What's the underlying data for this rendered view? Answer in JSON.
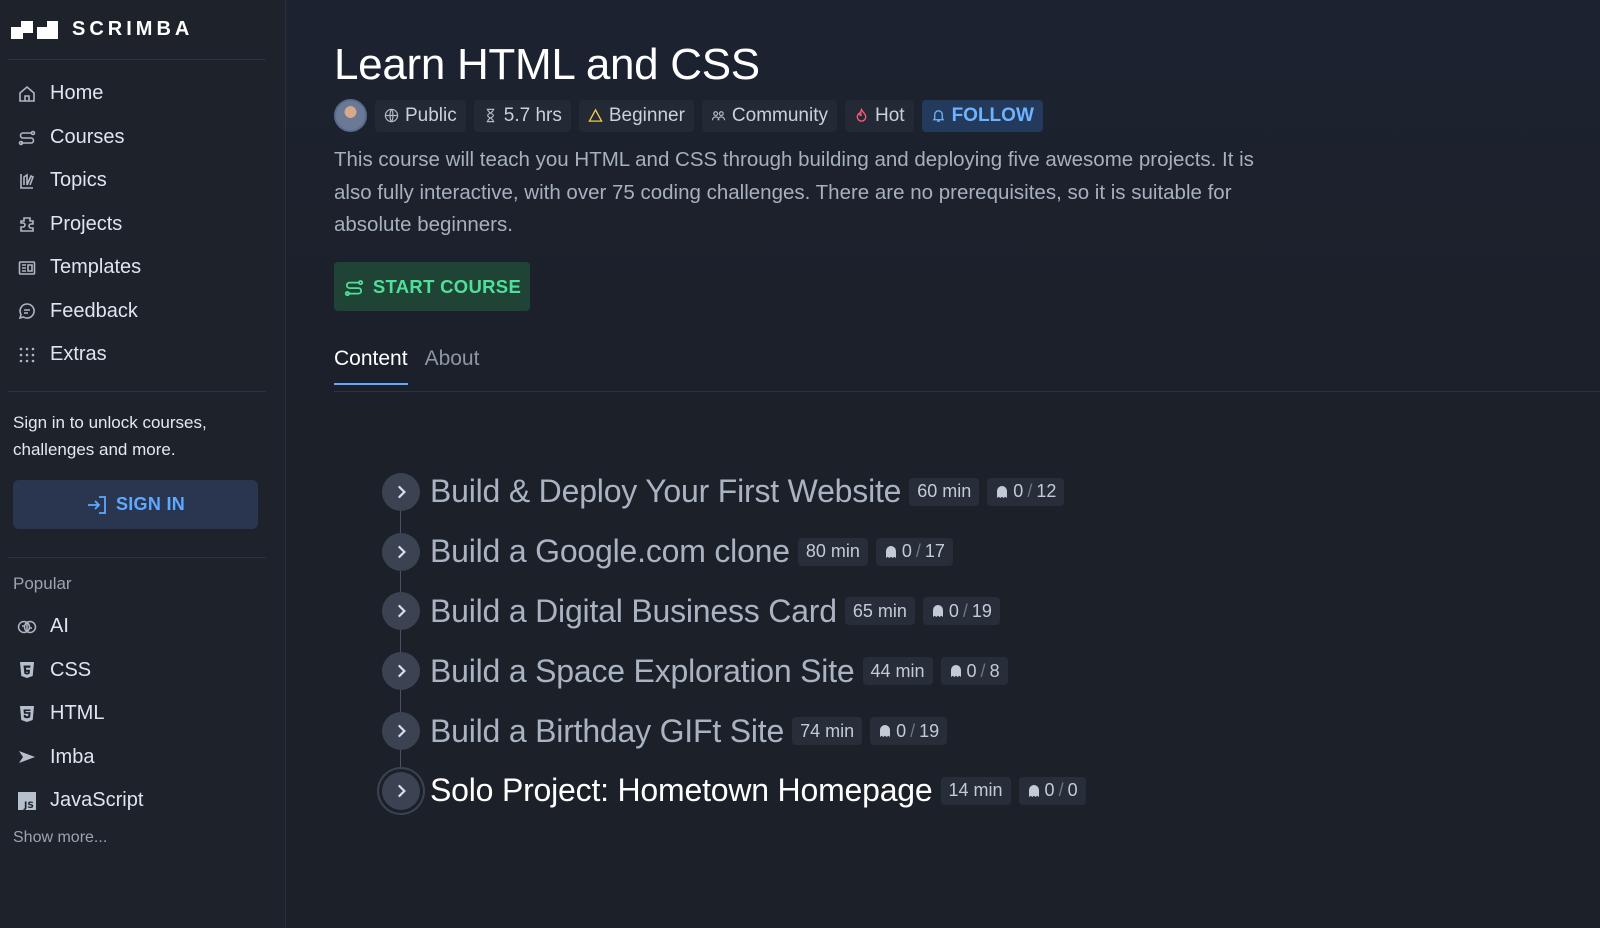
{
  "brand": {
    "name": "SCRIMBA"
  },
  "sidebar": {
    "nav": [
      {
        "label": "Home",
        "icon": "home-icon"
      },
      {
        "label": "Courses",
        "icon": "courses-icon"
      },
      {
        "label": "Topics",
        "icon": "topics-icon"
      },
      {
        "label": "Projects",
        "icon": "projects-icon"
      },
      {
        "label": "Templates",
        "icon": "templates-icon"
      },
      {
        "label": "Feedback",
        "icon": "feedback-icon"
      },
      {
        "label": "Extras",
        "icon": "extras-icon"
      }
    ],
    "signin_text": "Sign in to unlock courses, challenges and more.",
    "signin_button": "SIGN IN",
    "popular_label": "Popular",
    "popular": [
      {
        "label": "AI",
        "icon": "brain-icon"
      },
      {
        "label": "CSS",
        "icon": "css-icon"
      },
      {
        "label": "HTML",
        "icon": "html-icon"
      },
      {
        "label": "Imba",
        "icon": "imba-icon"
      },
      {
        "label": "JavaScript",
        "icon": "js-icon"
      }
    ],
    "show_more": "Show more..."
  },
  "course": {
    "title": "Learn HTML and CSS",
    "meta": {
      "visibility": "Public",
      "duration": "5.7 hrs",
      "level": "Beginner",
      "community": "Community",
      "hot": "Hot",
      "follow": "FOLLOW"
    },
    "description": "This course will teach you HTML and CSS through building and deploying five awesome projects. It is also fully interactive, with over 75 coding challenges. There are no prerequisites, so it is suitable for absolute beginners.",
    "start_button": "START COURSE"
  },
  "tabs": [
    {
      "label": "Content",
      "active": true
    },
    {
      "label": "About",
      "active": false
    }
  ],
  "lessons": [
    {
      "title": "Build & Deploy Your First Website",
      "duration": "60 min",
      "done": "0",
      "total": "12"
    },
    {
      "title": "Build a Google.com clone",
      "duration": "80 min",
      "done": "0",
      "total": "17"
    },
    {
      "title": "Build a Digital Business Card",
      "duration": "65 min",
      "done": "0",
      "total": "19"
    },
    {
      "title": "Build a Space Exploration Site",
      "duration": "44 min",
      "done": "0",
      "total": "8"
    },
    {
      "title": "Build a Birthday GIFt Site",
      "duration": "74 min",
      "done": "0",
      "total": "19"
    },
    {
      "title": "Solo Project: Hometown Homepage",
      "duration": "14 min",
      "done": "0",
      "total": "0"
    }
  ],
  "colors": {
    "accent_blue": "#5ea8ff",
    "start_green": "#4ee09a",
    "hot_red": "#ff5a7a",
    "beginner_yellow": "#f2c84b"
  }
}
